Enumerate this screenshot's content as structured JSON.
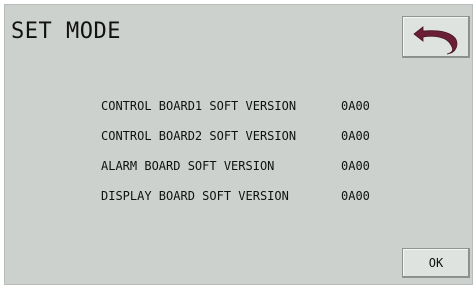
{
  "header": {
    "title": "SET MODE",
    "back_icon": "back-arrow-icon"
  },
  "versions": [
    {
      "label": "CONTROL BOARD1 SOFT VERSION",
      "value": "0A00"
    },
    {
      "label": "CONTROL BOARD2 SOFT VERSION",
      "value": "0A00"
    },
    {
      "label": "ALARM BOARD SOFT VERSION",
      "value": "0A00"
    },
    {
      "label": "DISPLAY BOARD SOFT VERSION",
      "value": "0A00"
    }
  ],
  "footer": {
    "ok_label": "OK"
  },
  "colors": {
    "screen_bg": "#ccd1cd",
    "button_bg": "#dfe3e0",
    "arrow": "#6a1f36"
  }
}
